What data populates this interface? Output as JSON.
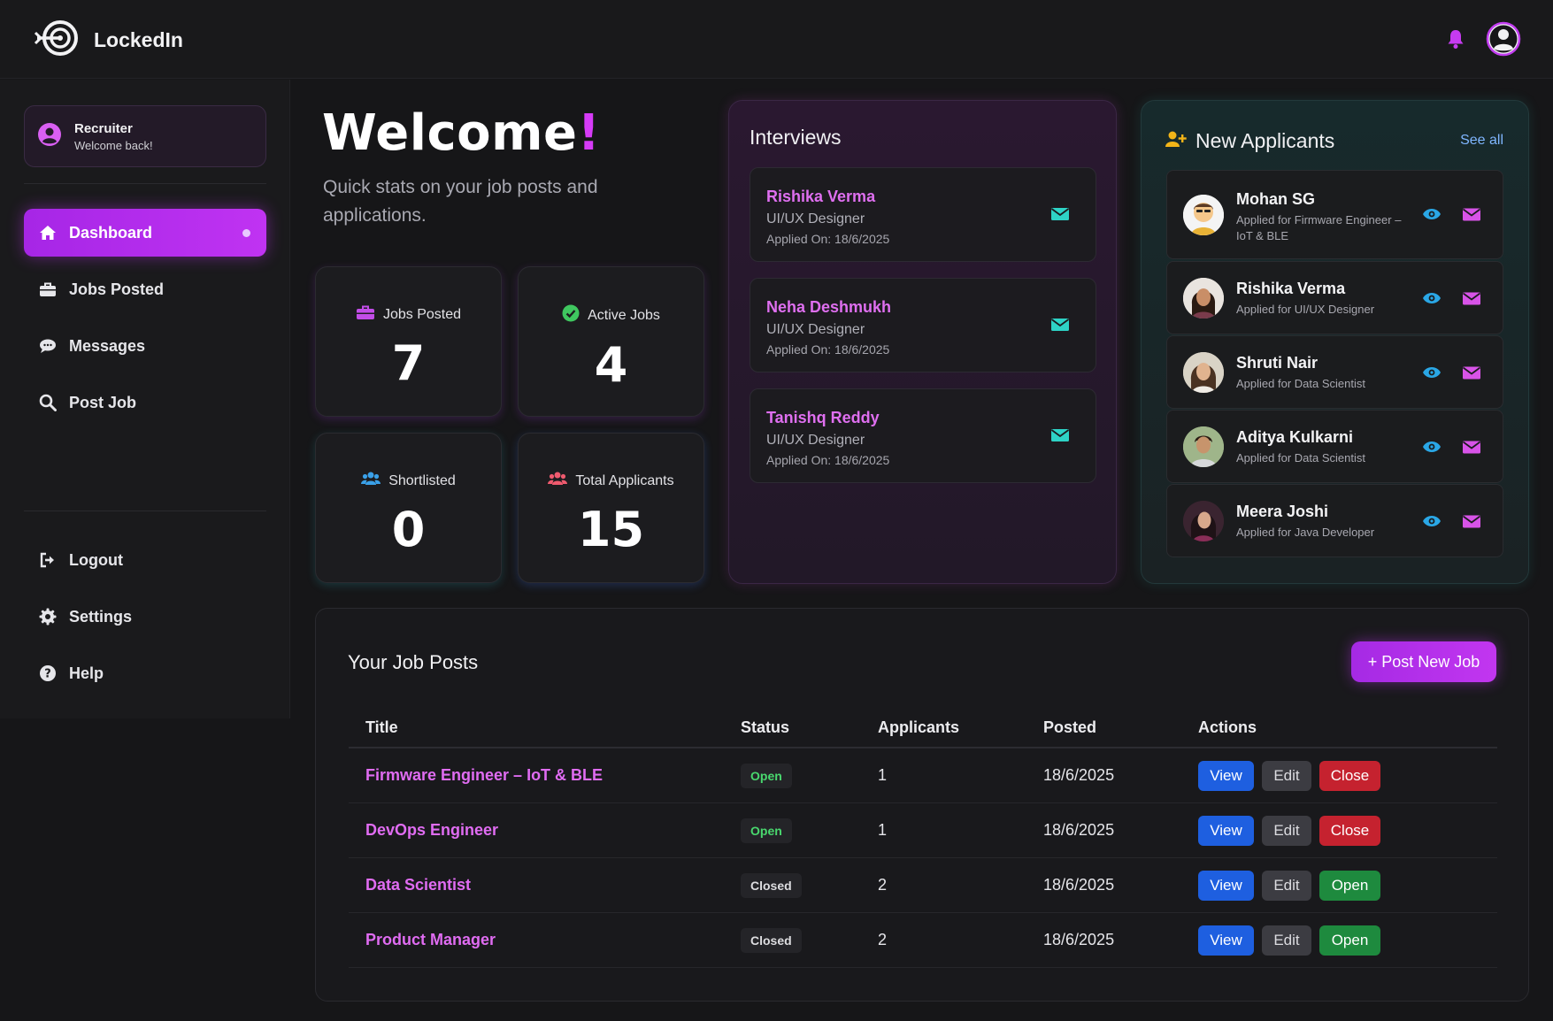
{
  "app": {
    "name": "LockedIn"
  },
  "sidebar": {
    "profile": {
      "role": "Recruiter",
      "greeting": "Welcome back!"
    },
    "items": [
      {
        "label": "Dashboard",
        "icon": "home-icon",
        "active": true
      },
      {
        "label": "Jobs Posted",
        "icon": "briefcase-icon"
      },
      {
        "label": "Messages",
        "icon": "chat-icon"
      },
      {
        "label": "Post Job",
        "icon": "search-icon"
      }
    ],
    "bottom_items": [
      {
        "label": "Logout",
        "icon": "logout-icon"
      },
      {
        "label": "Settings",
        "icon": "gear-icon"
      },
      {
        "label": "Help",
        "icon": "help-icon"
      }
    ]
  },
  "welcome": {
    "title": "Welcome",
    "exclaim": "!",
    "subtitle": "Quick stats on your job posts and applications."
  },
  "stats": [
    {
      "label": "Jobs Posted",
      "value": "7"
    },
    {
      "label": "Active Jobs",
      "value": "4"
    },
    {
      "label": "Shortlisted",
      "value": "0"
    },
    {
      "label": "Total Applicants",
      "value": "15"
    }
  ],
  "interviews": {
    "title": "Interviews",
    "items": [
      {
        "name": "Rishika Verma",
        "role": "UI/UX Designer",
        "applied": "Applied On: 18/6/2025"
      },
      {
        "name": "Neha Deshmukh",
        "role": "UI/UX Designer",
        "applied": "Applied On: 18/6/2025"
      },
      {
        "name": "Tanishq Reddy",
        "role": "UI/UX Designer",
        "applied": "Applied On: 18/6/2025"
      }
    ]
  },
  "new_applicants": {
    "title": "New Applicants",
    "see_all": "See all",
    "items": [
      {
        "name": "Mohan SG",
        "applied_for": "Applied for Firmware Engineer – IoT & BLE"
      },
      {
        "name": "Rishika Verma",
        "applied_for": "Applied for UI/UX Designer"
      },
      {
        "name": "Shruti Nair",
        "applied_for": "Applied for Data Scientist"
      },
      {
        "name": "Aditya Kulkarni",
        "applied_for": "Applied for Data Scientist"
      },
      {
        "name": "Meera Joshi",
        "applied_for": "Applied for Java Developer"
      }
    ]
  },
  "job_posts": {
    "title": "Your Job Posts",
    "post_button": "+ Post New Job",
    "columns": [
      "Title",
      "Status",
      "Applicants",
      "Posted",
      "Actions"
    ],
    "rows": [
      {
        "title": "Firmware Engineer – IoT & BLE",
        "status": "Open",
        "applicants": "1",
        "posted": "18/6/2025",
        "actions": [
          "View",
          "Edit",
          "Close"
        ]
      },
      {
        "title": "DevOps Engineer",
        "status": "Open",
        "applicants": "1",
        "posted": "18/6/2025",
        "actions": [
          "View",
          "Edit",
          "Close"
        ]
      },
      {
        "title": "Data Scientist",
        "status": "Closed",
        "applicants": "2",
        "posted": "18/6/2025",
        "actions": [
          "View",
          "Edit",
          "Open"
        ]
      },
      {
        "title": "Product Manager",
        "status": "Closed",
        "applicants": "2",
        "posted": "18/6/2025",
        "actions": [
          "View",
          "Edit",
          "Open"
        ]
      }
    ]
  },
  "colors": {
    "accent": "#c033f2",
    "name_pink": "#df6ff0",
    "teal": "#2ed3c6",
    "open_green": "#1e8a3e",
    "close_red": "#c5222f",
    "view_blue": "#1e5fe0"
  }
}
